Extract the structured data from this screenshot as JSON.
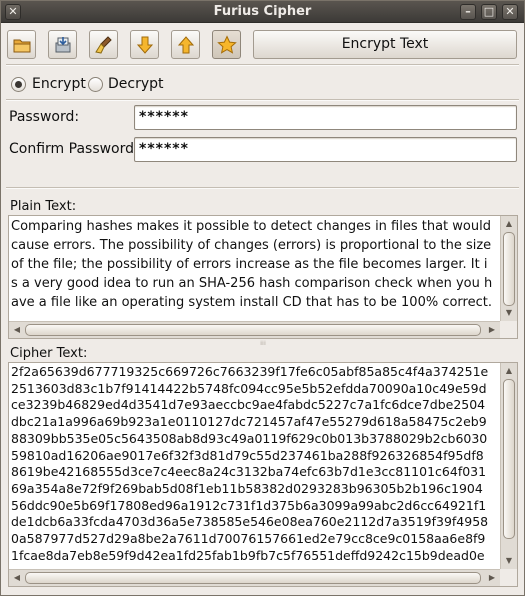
{
  "window": {
    "title": "Furius Cipher"
  },
  "toolbar": {
    "buttons": [
      {
        "icon": "open-folder-icon"
      },
      {
        "icon": "save-disk-icon"
      },
      {
        "icon": "clear-brush-icon"
      },
      {
        "icon": "arrow-down-icon"
      },
      {
        "icon": "arrow-up-icon"
      },
      {
        "icon": "star-icon"
      }
    ],
    "encrypt_text_label": "Encrypt Text"
  },
  "mode": {
    "encrypt_label": "Encrypt",
    "decrypt_label": "Decrypt",
    "selected": "Encrypt"
  },
  "form": {
    "password_label": "Password:",
    "password_value": "******",
    "confirm_label": "Confirm Password:",
    "confirm_value": "******"
  },
  "plain": {
    "label": "Plain Text:",
    "text": "Comparing hashes makes it possible to detect changes in files that would\ncause errors. The possibility of changes (errors) is proportional to the size\nof the file; the possibility of errors increase as the file becomes larger. It i\ns a very good idea to run an SHA-256 hash comparison check when you h\nave a file like an operating system install CD that has to be 100% correct."
  },
  "cipher": {
    "label": "Cipher Text:",
    "text": "2f2a65639d677719325c669726c7663239f17fe6c05abf85a85c4f4a374251e\n2513603d83c1b7f91414422b5748fc094cc95e5b52efdda70090a10c49e59d\nce3239b46829ed4d3541d7e93aeccbc9ae4fabdc5227c7a1fc6dce7dbe2504\ndbc21a1a996a69b923a1e0110127dc721457af47e55279d618a58475c2eb9\n88309bb535e05c5643508ab8d93c49a0119f629c0b013b3788029b2cb6030\n59810ad16206ae9017e6f32f3d81d79c55d237461ba288f926326854f95df8\n8619be42168555d3ce7c4eec8a24c3132ba74efc63b7d1e3cc81101c64f031\n69a354a8e72f9f269bab5d08f1eb11b58382d0293283b96305b2b196c1904\n56ddc90e5b69f17808ed96a1912c731f1d375b6a3099a99abc2d6cc64921f1\nde1dcb6a33fcda4703d36a5e738585e546e08ea760e2112d7a3519f39f4958\n0a587977d527d29a8be2a7611d70076157661ed2e79cc8ce9c0158aa6e8f9\n1fcae8da7eb8e59f9d42ea1fd25fab1b9fb7c5f76551deffd9242c15b9dead0e"
  },
  "colors": {
    "titlebar": "#3c3a37",
    "window_bg": "#efebe7",
    "star_button_active": "#cfc6b9"
  }
}
